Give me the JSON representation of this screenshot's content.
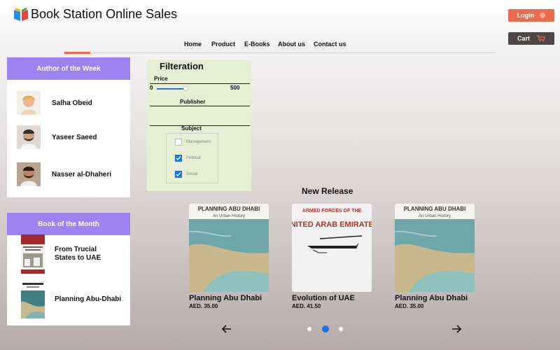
{
  "header": {
    "title": "Book Station Online Sales",
    "login_label": "Login",
    "cart_label": "Cart"
  },
  "nav": {
    "items": [
      {
        "label": "Home"
      },
      {
        "label": "Product"
      },
      {
        "label": "E-Books"
      },
      {
        "label": "About us"
      },
      {
        "label": "Contact us"
      }
    ],
    "active": "Home"
  },
  "author_panel": {
    "title": "Author of the Week",
    "authors": [
      {
        "name": "Salha Obeid"
      },
      {
        "name": "Yaseer Saeed"
      },
      {
        "name": "Nasser al-Dhaheri"
      }
    ]
  },
  "book_panel": {
    "title": "Book of the Month",
    "books": [
      {
        "line1": "From Trucial",
        "line2": "States to UAE"
      },
      {
        "line1": "Planning Abu-Dhabi",
        "line2": ""
      }
    ]
  },
  "filter": {
    "title": "Filteration",
    "price_label": "Price",
    "price_min": "0",
    "price_max": "500",
    "publisher_label": "Publisher",
    "subject_label": "Subject",
    "subjects": [
      {
        "label": "Management",
        "checked": false
      },
      {
        "label": "Political",
        "checked": true
      },
      {
        "label": "Social",
        "checked": true
      }
    ]
  },
  "new_release": {
    "title": "New Release",
    "books": [
      {
        "title": "Planning Abu Dhabi",
        "price": "AED. 35.00",
        "cover_title": "PLANNING ABU DHABI",
        "cover_sub": "An Urban History"
      },
      {
        "title": "Evolution of UAE",
        "price": "AED. 41.50",
        "cover_title": "UNITED ARAB EMIRATES",
        "cover_sub": "ARMED FORCES OF THE"
      },
      {
        "title": "Planning Abu Dhabi",
        "price": "AED. 35.00",
        "cover_title": "PLANNING ABU DHABI",
        "cover_sub": "An Urban History"
      }
    ],
    "active_page": 2,
    "page_count": 3
  },
  "colors": {
    "accent": "#ee6a4c",
    "panel_header": "#9b83f2",
    "cart_button": "#4e4747",
    "filter_bg": "#e6efd4",
    "dot_active": "#1a73e8"
  }
}
